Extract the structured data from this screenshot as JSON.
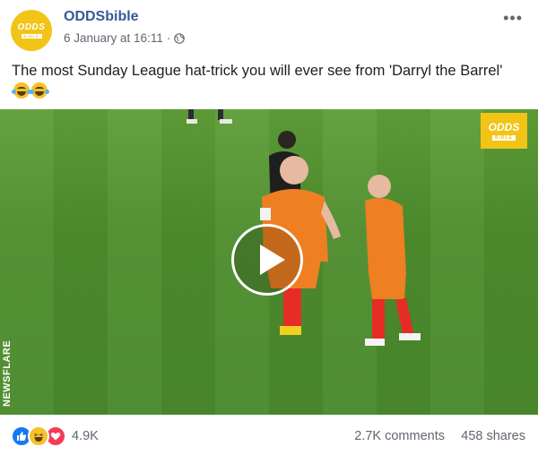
{
  "post": {
    "page_name": "ODDSbible",
    "timestamp": "6 January at 16:11",
    "separator": "·",
    "audience_icon": "globe-icon",
    "more_icon": "more-horizontal-icon",
    "caption": "The most Sunday League hat-trick you will ever see from 'Darryl the Barrel'",
    "caption_emojis": [
      "joy-emoji",
      "joy-emoji"
    ],
    "avatar_logo": {
      "top": "ODDS",
      "bottom": "BIBLE"
    }
  },
  "video": {
    "watermark_logo": {
      "top": "ODDS",
      "bottom": "BIBLE"
    },
    "watermark_text": "NEWSFLARE",
    "play_icon": "play-icon"
  },
  "footer": {
    "reaction_icons": [
      "like-icon",
      "haha-icon",
      "love-icon"
    ],
    "reaction_count": "4.9K",
    "comments": "2.7K comments",
    "shares": "458 shares"
  },
  "colors": {
    "page_name": "#385898",
    "brand_yellow": "#f2c417",
    "like_blue": "#1877f2",
    "love_red": "#f33e58",
    "muted_text": "#606770"
  }
}
